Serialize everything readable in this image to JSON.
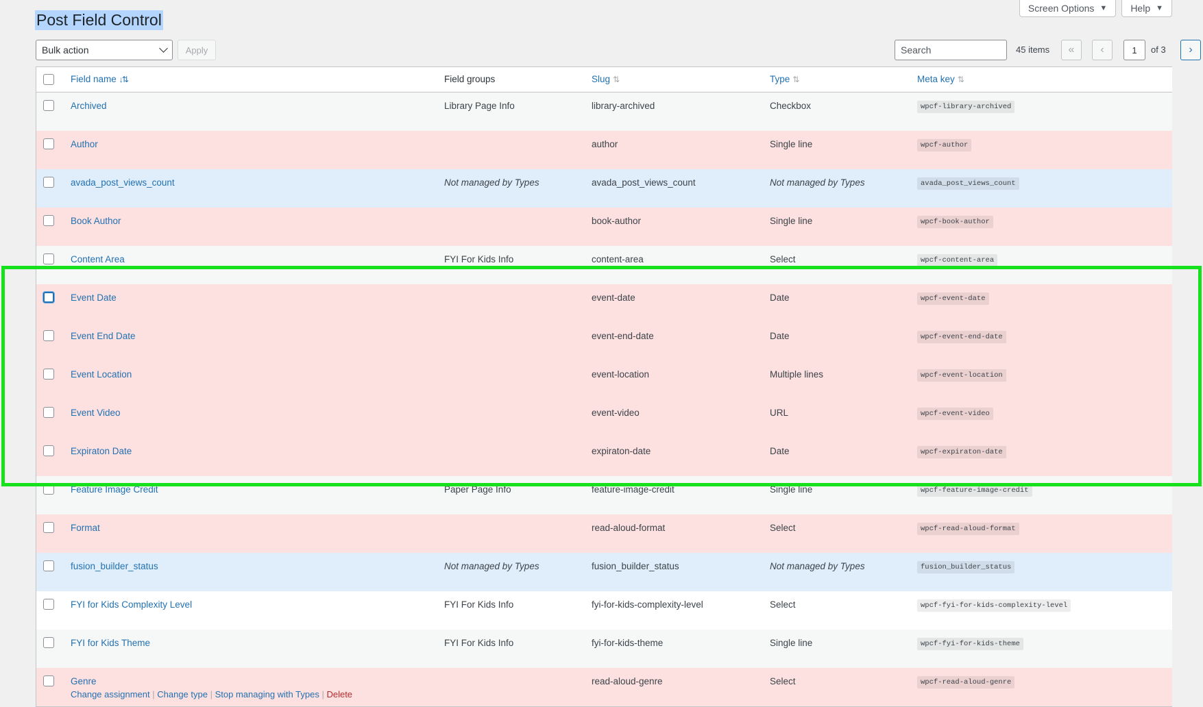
{
  "page_title": "Post Field Control",
  "screen_options": {
    "screen_options_label": "Screen Options",
    "help_label": "Help",
    "dropdown_glyph": "▼"
  },
  "tablenav": {
    "bulk_action": "Bulk action",
    "apply_label": "Apply",
    "search_placeholder": "Search",
    "items_count": "45 items",
    "first_glyph": "«",
    "prev_glyph": "‹",
    "next_glyph": "›",
    "last_glyph": "»",
    "current_page": "1",
    "of_pages": "of 3"
  },
  "columns": {
    "field_name": "Field name",
    "field_groups": "Field groups",
    "slug": "Slug",
    "type": "Type",
    "meta_key": "Meta key",
    "sort_active_glyph": "↓⇅",
    "sort_glyph": "⇅"
  },
  "rows": [
    {
      "name": "Archived",
      "group": "Library Page Info",
      "slug": "library-archived",
      "type": "Checkbox",
      "meta": "wpcf-library-archived",
      "bg": "stripe"
    },
    {
      "name": "Author",
      "group": "",
      "slug": "author",
      "type": "Single line",
      "meta": "wpcf-author",
      "bg": "pink"
    },
    {
      "name": "avada_post_views_count",
      "group": "Not managed by Types",
      "slug": "avada_post_views_count",
      "type": "Not managed by Types",
      "meta": "avada_post_views_count",
      "bg": "blue"
    },
    {
      "name": "Book Author",
      "group": "",
      "slug": "book-author",
      "type": "Single line",
      "meta": "wpcf-book-author",
      "bg": "pink"
    },
    {
      "name": "Content Area",
      "group": "FYI For Kids Info",
      "slug": "content-area",
      "type": "Select",
      "meta": "wpcf-content-area",
      "bg": "stripe"
    },
    {
      "name": "Event Date",
      "group": "",
      "slug": "event-date",
      "type": "Date",
      "meta": "wpcf-event-date",
      "bg": "pink"
    },
    {
      "name": "Event End Date",
      "group": "",
      "slug": "event-end-date",
      "type": "Date",
      "meta": "wpcf-event-end-date",
      "bg": "pink"
    },
    {
      "name": "Event Location",
      "group": "",
      "slug": "event-location",
      "type": "Multiple lines",
      "meta": "wpcf-event-location",
      "bg": "pink"
    },
    {
      "name": "Event Video",
      "group": "",
      "slug": "event-video",
      "type": "URL",
      "meta": "wpcf-event-video",
      "bg": "pink"
    },
    {
      "name": "Expiraton Date",
      "group": "",
      "slug": "expiraton-date",
      "type": "Date",
      "meta": "wpcf-expiraton-date",
      "bg": "pink"
    },
    {
      "name": "Feature Image Credit",
      "group": "Paper Page Info",
      "slug": "feature-image-credit",
      "type": "Single line",
      "meta": "wpcf-feature-image-credit",
      "bg": "stripe"
    },
    {
      "name": "Format",
      "group": "",
      "slug": "read-aloud-format",
      "type": "Select",
      "meta": "wpcf-read-aloud-format",
      "bg": "pink"
    },
    {
      "name": "fusion_builder_status",
      "group": "Not managed by Types",
      "slug": "fusion_builder_status",
      "type": "Not managed by Types",
      "meta": "fusion_builder_status",
      "bg": "blue"
    },
    {
      "name": "FYI for Kids Complexity Level",
      "group": "FYI For Kids Info",
      "slug": "fyi-for-kids-complexity-level",
      "type": "Select",
      "meta": "wpcf-fyi-for-kids-complexity-level",
      "bg": "white"
    },
    {
      "name": "FYI for Kids Theme",
      "group": "FYI For Kids Info",
      "slug": "fyi-for-kids-theme",
      "type": "Single line",
      "meta": "wpcf-fyi-for-kids-theme",
      "bg": "stripe"
    },
    {
      "name": "Genre",
      "group": "",
      "slug": "read-aloud-genre",
      "type": "Select",
      "meta": "wpcf-read-aloud-genre",
      "bg": "pink"
    }
  ],
  "row_actions": {
    "change_assignment": "Change assignment",
    "change_type": "Change type",
    "stop_managing": "Stop managing with Types",
    "delete": "Delete",
    "separator": "|"
  }
}
